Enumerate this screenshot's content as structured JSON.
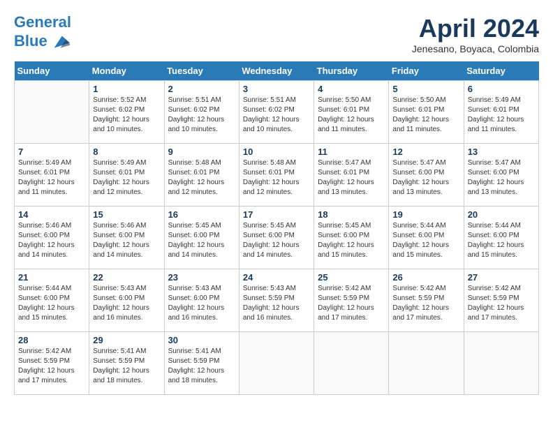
{
  "header": {
    "logo_line1": "General",
    "logo_line2": "Blue",
    "month_title": "April 2024",
    "location": "Jenesano, Boyaca, Colombia"
  },
  "weekdays": [
    "Sunday",
    "Monday",
    "Tuesday",
    "Wednesday",
    "Thursday",
    "Friday",
    "Saturday"
  ],
  "weeks": [
    [
      {
        "day": "",
        "empty": true
      },
      {
        "day": "1",
        "sunrise": "5:52 AM",
        "sunset": "6:02 PM",
        "daylight": "12 hours and 10 minutes."
      },
      {
        "day": "2",
        "sunrise": "5:51 AM",
        "sunset": "6:02 PM",
        "daylight": "12 hours and 10 minutes."
      },
      {
        "day": "3",
        "sunrise": "5:51 AM",
        "sunset": "6:02 PM",
        "daylight": "12 hours and 10 minutes."
      },
      {
        "day": "4",
        "sunrise": "5:50 AM",
        "sunset": "6:01 PM",
        "daylight": "12 hours and 11 minutes."
      },
      {
        "day": "5",
        "sunrise": "5:50 AM",
        "sunset": "6:01 PM",
        "daylight": "12 hours and 11 minutes."
      },
      {
        "day": "6",
        "sunrise": "5:49 AM",
        "sunset": "6:01 PM",
        "daylight": "12 hours and 11 minutes."
      }
    ],
    [
      {
        "day": "7",
        "sunrise": "5:49 AM",
        "sunset": "6:01 PM",
        "daylight": "12 hours and 11 minutes."
      },
      {
        "day": "8",
        "sunrise": "5:49 AM",
        "sunset": "6:01 PM",
        "daylight": "12 hours and 12 minutes."
      },
      {
        "day": "9",
        "sunrise": "5:48 AM",
        "sunset": "6:01 PM",
        "daylight": "12 hours and 12 minutes."
      },
      {
        "day": "10",
        "sunrise": "5:48 AM",
        "sunset": "6:01 PM",
        "daylight": "12 hours and 12 minutes."
      },
      {
        "day": "11",
        "sunrise": "5:47 AM",
        "sunset": "6:01 PM",
        "daylight": "12 hours and 13 minutes."
      },
      {
        "day": "12",
        "sunrise": "5:47 AM",
        "sunset": "6:00 PM",
        "daylight": "12 hours and 13 minutes."
      },
      {
        "day": "13",
        "sunrise": "5:47 AM",
        "sunset": "6:00 PM",
        "daylight": "12 hours and 13 minutes."
      }
    ],
    [
      {
        "day": "14",
        "sunrise": "5:46 AM",
        "sunset": "6:00 PM",
        "daylight": "12 hours and 14 minutes."
      },
      {
        "day": "15",
        "sunrise": "5:46 AM",
        "sunset": "6:00 PM",
        "daylight": "12 hours and 14 minutes."
      },
      {
        "day": "16",
        "sunrise": "5:45 AM",
        "sunset": "6:00 PM",
        "daylight": "12 hours and 14 minutes."
      },
      {
        "day": "17",
        "sunrise": "5:45 AM",
        "sunset": "6:00 PM",
        "daylight": "12 hours and 14 minutes."
      },
      {
        "day": "18",
        "sunrise": "5:45 AM",
        "sunset": "6:00 PM",
        "daylight": "12 hours and 15 minutes."
      },
      {
        "day": "19",
        "sunrise": "5:44 AM",
        "sunset": "6:00 PM",
        "daylight": "12 hours and 15 minutes."
      },
      {
        "day": "20",
        "sunrise": "5:44 AM",
        "sunset": "6:00 PM",
        "daylight": "12 hours and 15 minutes."
      }
    ],
    [
      {
        "day": "21",
        "sunrise": "5:44 AM",
        "sunset": "6:00 PM",
        "daylight": "12 hours and 15 minutes."
      },
      {
        "day": "22",
        "sunrise": "5:43 AM",
        "sunset": "6:00 PM",
        "daylight": "12 hours and 16 minutes."
      },
      {
        "day": "23",
        "sunrise": "5:43 AM",
        "sunset": "6:00 PM",
        "daylight": "12 hours and 16 minutes."
      },
      {
        "day": "24",
        "sunrise": "5:43 AM",
        "sunset": "5:59 PM",
        "daylight": "12 hours and 16 minutes."
      },
      {
        "day": "25",
        "sunrise": "5:42 AM",
        "sunset": "5:59 PM",
        "daylight": "12 hours and 17 minutes."
      },
      {
        "day": "26",
        "sunrise": "5:42 AM",
        "sunset": "5:59 PM",
        "daylight": "12 hours and 17 minutes."
      },
      {
        "day": "27",
        "sunrise": "5:42 AM",
        "sunset": "5:59 PM",
        "daylight": "12 hours and 17 minutes."
      }
    ],
    [
      {
        "day": "28",
        "sunrise": "5:42 AM",
        "sunset": "5:59 PM",
        "daylight": "12 hours and 17 minutes."
      },
      {
        "day": "29",
        "sunrise": "5:41 AM",
        "sunset": "5:59 PM",
        "daylight": "12 hours and 18 minutes."
      },
      {
        "day": "30",
        "sunrise": "5:41 AM",
        "sunset": "5:59 PM",
        "daylight": "12 hours and 18 minutes."
      },
      {
        "day": "",
        "empty": true
      },
      {
        "day": "",
        "empty": true
      },
      {
        "day": "",
        "empty": true
      },
      {
        "day": "",
        "empty": true
      }
    ]
  ]
}
